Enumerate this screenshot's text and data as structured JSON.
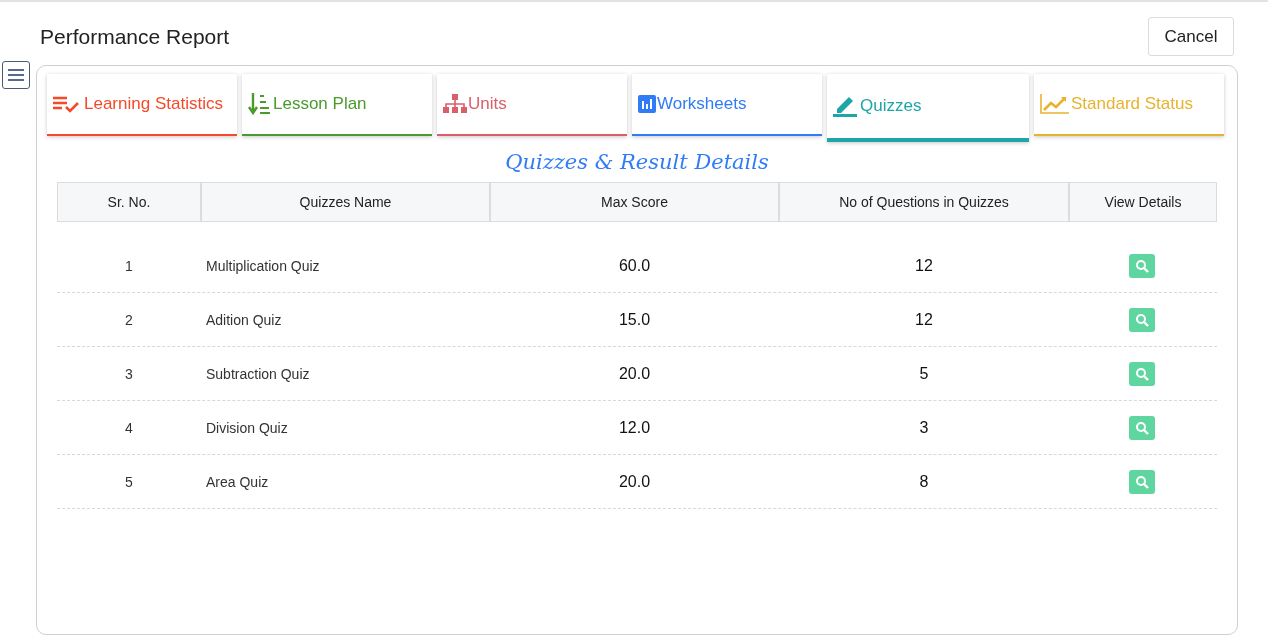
{
  "title": "Performance Report",
  "cancel_button": "Cancel",
  "tabs": [
    {
      "label": "Learning Statistics",
      "kind": "stats",
      "color": "#f44a2a",
      "selected": false
    },
    {
      "label": "Lesson Plan",
      "kind": "plan",
      "color": "#4a9a2c",
      "selected": false
    },
    {
      "label": "Units",
      "kind": "units",
      "color": "#d9606a",
      "selected": false
    },
    {
      "label": "Worksheets",
      "kind": "worksheets",
      "color": "#2f7cf6",
      "selected": false
    },
    {
      "label": "Quizzes",
      "kind": "quizzes",
      "color": "#1ea6a6",
      "selected": true
    },
    {
      "label": "Standard Status",
      "kind": "standards",
      "color": "#e8b22e",
      "selected": false
    }
  ],
  "section_heading": "Quizzes & Result Details",
  "table": {
    "columns": [
      "Sr. No.",
      "Quizzes Name",
      "Max Score",
      "No of Questions in Quizzes",
      "View Details"
    ],
    "rows": [
      {
        "sr_no": "1",
        "name": "Multiplication Quiz",
        "max_score": "60.0",
        "questions": "12"
      },
      {
        "sr_no": "2",
        "name": "Adition Quiz",
        "max_score": "15.0",
        "questions": "12"
      },
      {
        "sr_no": "3",
        "name": "Subtraction Quiz",
        "max_score": "20.0",
        "questions": "5"
      },
      {
        "sr_no": "4",
        "name": "Division Quiz",
        "max_score": "12.0",
        "questions": "3"
      },
      {
        "sr_no": "5",
        "name": "Area Quiz",
        "max_score": "20.0",
        "questions": "8"
      }
    ]
  }
}
